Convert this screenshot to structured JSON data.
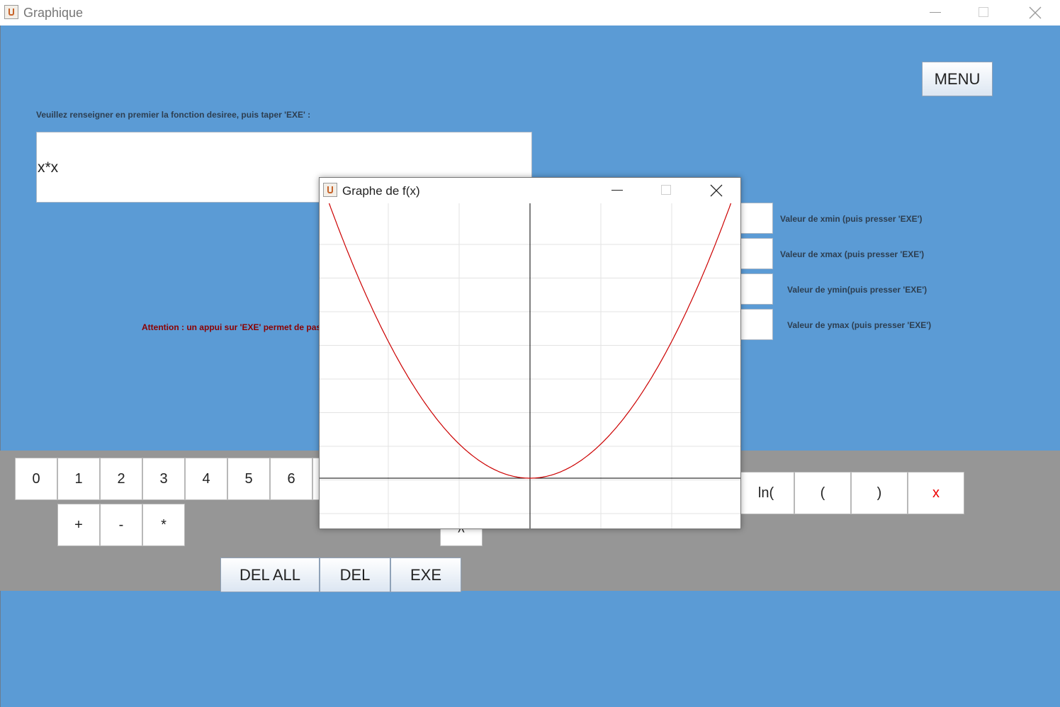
{
  "window": {
    "title": "Graphique"
  },
  "menu_button": "MENU",
  "instruction": "Veuillez renseigner en premier la fonction desiree, puis taper 'EXE' :",
  "function_input": {
    "value": "x*x"
  },
  "warning": "Attention : un appui sur 'EXE' permet de pass",
  "range_labels": {
    "xmin": "Valeur de xmin (puis presser 'EXE')",
    "xmax": "Valeur de xmax (puis presser 'EXE')",
    "ymin": "Valeur de ymin(puis presser 'EXE')",
    "ymax": "Valeur de ymax (puis presser 'EXE')"
  },
  "keypad": {
    "digits": [
      "0",
      "1",
      "2",
      "3",
      "4",
      "5",
      "6"
    ],
    "ops": [
      "+",
      "-",
      "*"
    ],
    "partial": "^",
    "right": [
      "ln(",
      "(",
      ")",
      "x"
    ]
  },
  "actions": {
    "del_all": "DEL ALL",
    "del": "DEL",
    "exe": "EXE"
  },
  "graph_window": {
    "title": "Graphe de f(x)"
  },
  "colors": {
    "background": "#5b9bd5",
    "band": "#969696",
    "curve": "#cc0000",
    "x_key": "#ee0000",
    "warning": "#8b0000"
  },
  "chart_data": {
    "type": "line",
    "function": "x*x",
    "series": [
      {
        "x": [
          -3,
          -2.5,
          -2,
          -1.5,
          -1,
          -0.5,
          0,
          0.5,
          1,
          1.5,
          2,
          2.5,
          3
        ],
        "y": [
          9,
          6.25,
          4,
          2.25,
          1,
          0.25,
          0,
          0.25,
          1,
          2.25,
          4,
          6.25,
          9
        ]
      }
    ],
    "xlim": [
      -3,
      3
    ],
    "ylim": [
      -1.5,
      8.2
    ],
    "grid": true,
    "axes_color": "#000000",
    "curve_color": "#cc0000"
  }
}
